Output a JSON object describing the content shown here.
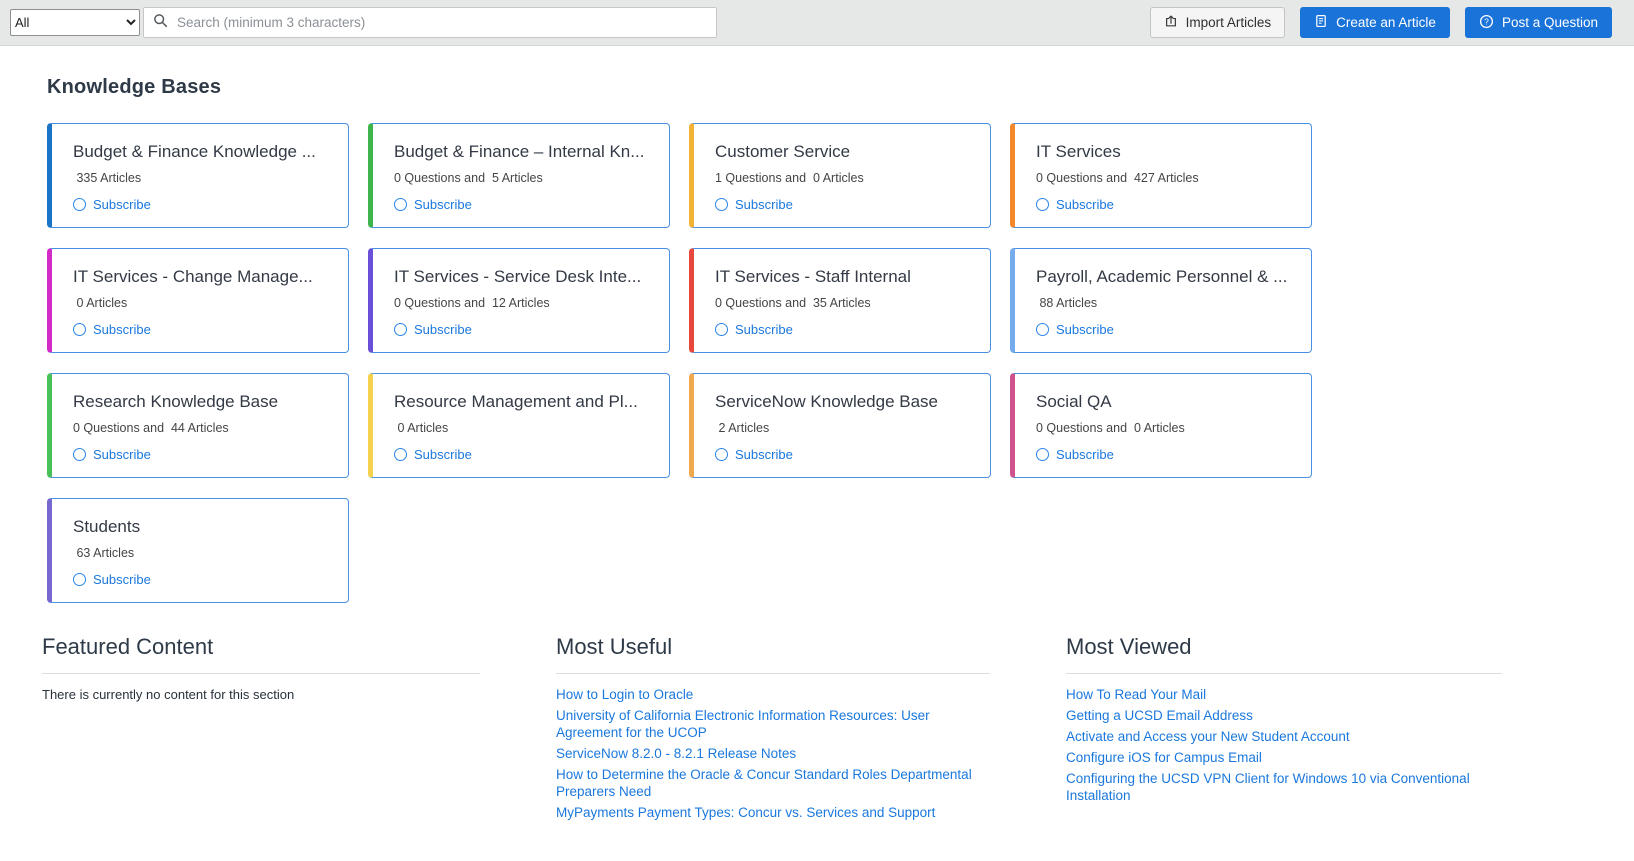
{
  "topbar": {
    "filter": {
      "value": "All"
    },
    "search": {
      "placeholder": "Search (minimum 3 characters)"
    },
    "import_button": "Import Articles",
    "create_button": "Create an Article",
    "post_button": "Post a Question"
  },
  "heading": "Knowledge Bases",
  "cards": [
    {
      "title": "Budget & Finance Knowledge ...",
      "count": " 335 Articles",
      "subscribe_label": "Subscribe",
      "accent": "#1b74c5"
    },
    {
      "title": "Budget & Finance – Internal Kn...",
      "count": "0 Questions and  5 Articles",
      "subscribe_label": "Subscribe",
      "accent": "#3eb54b"
    },
    {
      "title": "Customer Service",
      "count": "1 Questions and  0 Articles",
      "subscribe_label": "Subscribe",
      "accent": "#f2b234"
    },
    {
      "title": "IT Services",
      "count": "0 Questions and  427 Articles",
      "subscribe_label": "Subscribe",
      "accent": "#f6882c"
    },
    {
      "title": "IT Services - Change Manage...",
      "count": " 0 Articles",
      "subscribe_label": "Subscribe",
      "accent": "#d32cc6"
    },
    {
      "title": "IT Services - Service Desk Inte...",
      "count": "0 Questions and  12 Articles",
      "subscribe_label": "Subscribe",
      "accent": "#6a4fd8"
    },
    {
      "title": "IT Services - Staff Internal",
      "count": "0 Questions and  35 Articles",
      "subscribe_label": "Subscribe",
      "accent": "#e8473c"
    },
    {
      "title": "Payroll, Academic Personnel & ...",
      "count": " 88 Articles",
      "subscribe_label": "Subscribe",
      "accent": "#74abec"
    },
    {
      "title": "Research Knowledge Base",
      "count": "0 Questions and  44 Articles",
      "subscribe_label": "Subscribe",
      "accent": "#47c158"
    },
    {
      "title": "Resource Management and Pl...",
      "count": " 0 Articles",
      "subscribe_label": "Subscribe",
      "accent": "#f6d14e"
    },
    {
      "title": "ServiceNow Knowledge Base",
      "count": " 2 Articles",
      "subscribe_label": "Subscribe",
      "accent": "#f0a94f"
    },
    {
      "title": "Social QA",
      "count": "0 Questions and  0 Articles",
      "subscribe_label": "Subscribe",
      "accent": "#d0538f"
    },
    {
      "title": "Students",
      "count": " 63 Articles",
      "subscribe_label": "Subscribe",
      "accent": "#7668ce"
    }
  ],
  "featured": {
    "title": "Featured Content",
    "empty_text": "There is currently no content for this section"
  },
  "most_useful": {
    "title": "Most Useful",
    "links": [
      {
        "label": "How to Login to Oracle"
      },
      {
        "label": "University of California Electronic Information Resources: User Agreement for the UCOP"
      },
      {
        "label": "ServiceNow 8.2.0 - 8.2.1 Release Notes"
      },
      {
        "label": "How to Determine the Oracle & Concur Standard Roles Departmental Preparers Need"
      },
      {
        "label": "MyPayments Payment Types: Concur vs. Services and Support"
      }
    ]
  },
  "most_viewed": {
    "title": "Most Viewed",
    "links": [
      {
        "label": "How To Read Your Mail"
      },
      {
        "label": "Getting a UCSD Email Address"
      },
      {
        "label": "Activate and Access your New Student Account"
      },
      {
        "label": "Configure iOS for Campus Email"
      },
      {
        "label": "Configuring the UCSD VPN Client for Windows 10 via Conventional Installation"
      }
    ]
  },
  "colors": {
    "primary_blue": "#1a73d8",
    "link_blue": "#1a78dd",
    "card_border_blue": "#4a90e2",
    "topbar_gray": "#e6e7e7"
  }
}
